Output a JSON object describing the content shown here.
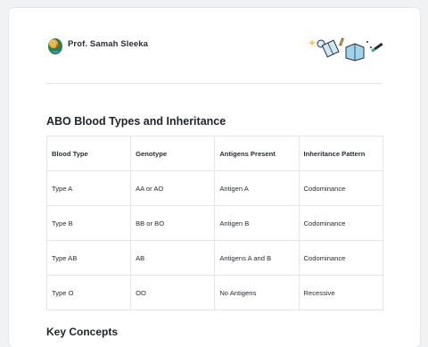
{
  "header": {
    "author": "Prof. Samah Sleeka",
    "avatar_icon": "parrot-icon",
    "illustration_icon": "study-supplies-icon"
  },
  "section": {
    "title": "ABO Blood Types and Inheritance",
    "next_title": "Key Concepts"
  },
  "table": {
    "headers": [
      "Blood Type",
      "Genotype",
      "Antigens Present",
      "Inheritance Pattern"
    ],
    "rows": [
      [
        "Type A",
        "AA or AO",
        "Antigen A",
        "Codominance"
      ],
      [
        "Type B",
        "BB or BO",
        "Antigen B",
        "Codominance"
      ],
      [
        "Type AB",
        "AB",
        "Antigens A and B",
        "Codominance"
      ],
      [
        "Type O",
        "OO",
        "No Antigens",
        "Recessive"
      ]
    ]
  },
  "colors": {
    "background": "#f1f2f4",
    "card": "#ffffff",
    "border": "#e3e5e8",
    "text": "#1f2328"
  }
}
